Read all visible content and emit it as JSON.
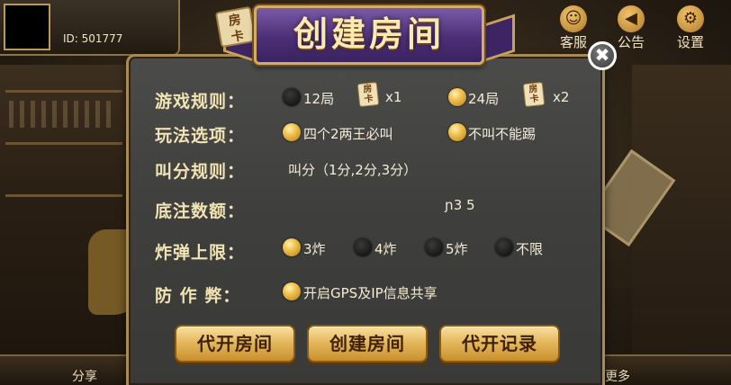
{
  "header": {
    "user_id": "ID: 501777",
    "kefu_label": "客服",
    "notice_label": "公告",
    "settings_label": "设置",
    "share_label": "分享",
    "more_label": "更多"
  },
  "dialog": {
    "title": "创建房间",
    "title_card": [
      "房",
      "卡"
    ],
    "rules": {
      "label": "游戏规则：",
      "options": [
        {
          "text": "12局",
          "cost": "x1",
          "selected": false
        },
        {
          "text": "24局",
          "cost": "x2",
          "selected": true
        }
      ],
      "card_chars": [
        "房",
        "卡"
      ]
    },
    "play_options": {
      "label": "玩法选项：",
      "options": [
        {
          "text": "四个2两王必叫",
          "selected": true
        },
        {
          "text": "不叫不能踢",
          "selected": true
        }
      ]
    },
    "bid_rules": {
      "label": "叫分规则：",
      "value": "叫分（1分,2分,3分）"
    },
    "base_bet": {
      "label": "底注数额：",
      "value": "ɲ3 5"
    },
    "bomb_limit": {
      "label": "炸弹上限：",
      "options": [
        {
          "text": "3炸",
          "selected": true
        },
        {
          "text": "4炸",
          "selected": false
        },
        {
          "text": "5炸",
          "selected": false
        },
        {
          "text": "不限",
          "selected": false
        }
      ]
    },
    "anti_cheat": {
      "label": "防 作 弊：",
      "option": {
        "text": "开启GPS及IP信息共享",
        "selected": true
      }
    },
    "buttons": {
      "proxy_open": "代开房间",
      "create": "创建房间",
      "proxy_records": "代开记录"
    },
    "close_symbol": "✖"
  },
  "colors": {
    "accent_gold": "#f3c454",
    "banner_purple": "#4c2f76",
    "panel_gray": "#434341",
    "label_cream": "#f2e3b3"
  }
}
